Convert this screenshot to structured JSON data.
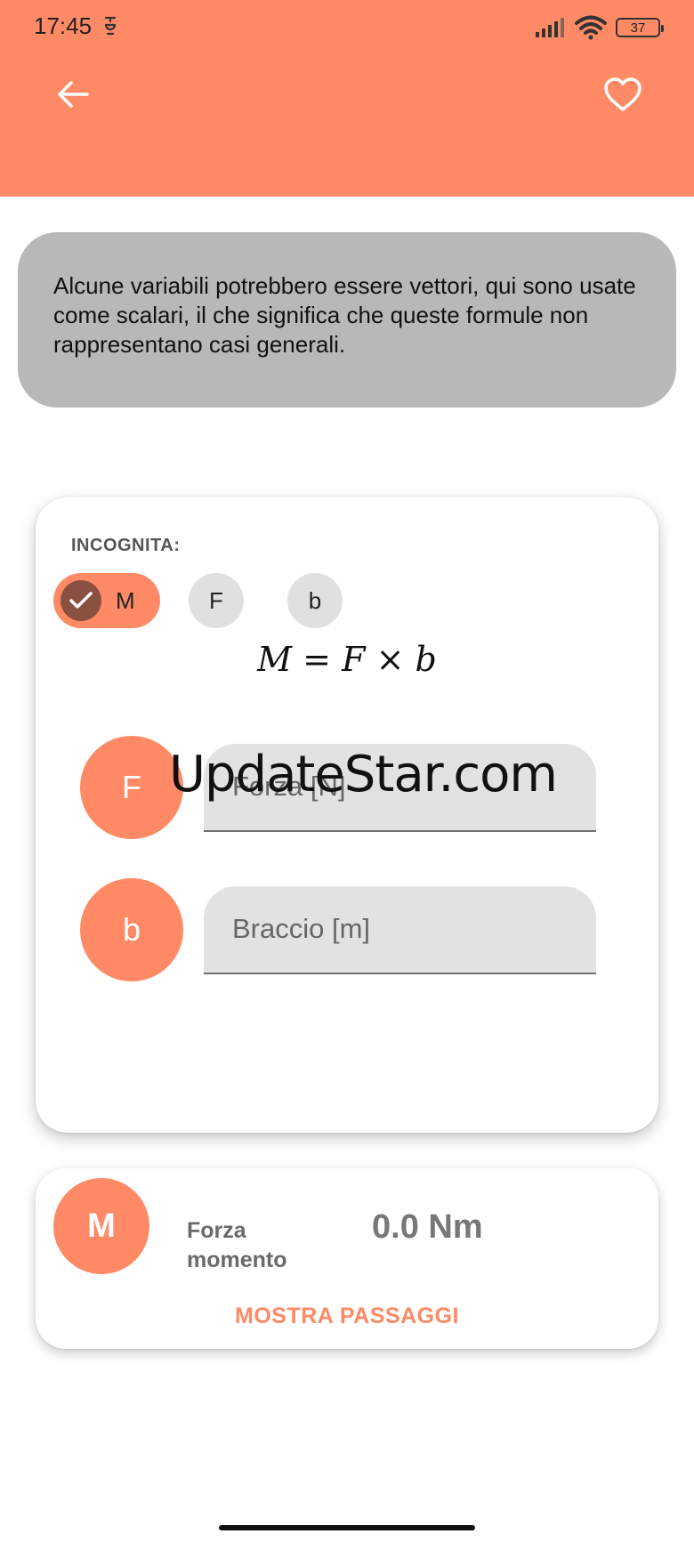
{
  "status_bar": {
    "time": "17:45",
    "battery": "37",
    "icons": [
      "notification-icon",
      "signal-icon",
      "wifi-icon",
      "battery-icon"
    ]
  },
  "app_bar": {
    "back_icon": "arrow-left-icon",
    "favorite_icon": "heart-outline-icon",
    "color": "#FF8A65"
  },
  "notice": {
    "text": "Alcune variabili potrebbero essere vettori, qui sono usate come scalari, il che significa che queste formule non rappresentano casi generali."
  },
  "calculator": {
    "unknown_label": "INCOGNITA:",
    "chips": [
      {
        "label": "M",
        "selected": true
      },
      {
        "label": "F",
        "selected": false
      },
      {
        "label": "b",
        "selected": false
      }
    ],
    "formula": {
      "lhs": "M",
      "equals": "=",
      "a": "F",
      "op": "×",
      "b": "b"
    },
    "inputs": [
      {
        "symbol": "F",
        "placeholder": "Forza [N]",
        "value": ""
      },
      {
        "symbol": "b",
        "placeholder": "Braccio [m]",
        "value": ""
      }
    ]
  },
  "watermark": {
    "text": "UpdateStar.com"
  },
  "result": {
    "symbol": "M",
    "name": "Forza momento",
    "value": "0.0 Nm",
    "action": "MOSTRA PASSAGGI"
  },
  "colors": {
    "accent": "#FF8A65",
    "notice_bg": "#B8B8B8",
    "chip_unselected": "#E0E0E0",
    "check_bg": "#8A5040"
  }
}
